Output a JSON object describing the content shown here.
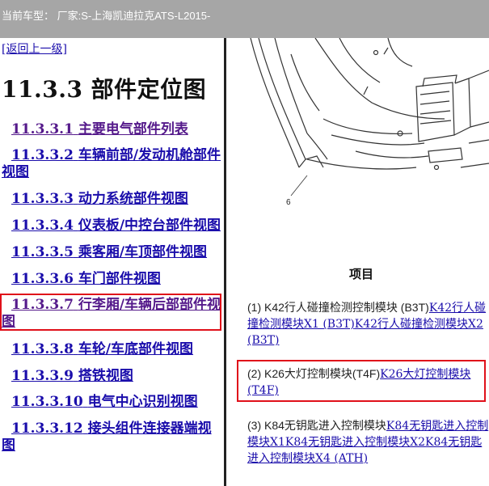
{
  "header": {
    "title": "当前车型：   厂家:S-上海凯迪拉克ATS-L2015-"
  },
  "left": {
    "back_link": "[返回上一级]",
    "heading": "11.3.3 部件定位图",
    "nav": [
      {
        "num": "11.3.3.1",
        "label": "主要电气部件列表"
      },
      {
        "num": "11.3.3.2",
        "label": "车辆前部/发动机舱部件",
        "cont": "视图"
      },
      {
        "num": "11.3.3.3",
        "label": "动力系统部件视图"
      },
      {
        "num": "11.3.3.4",
        "label": "仪表板/中控台部件视图"
      },
      {
        "num": "11.3.3.5",
        "label": "乘客厢/车顶部件视图"
      },
      {
        "num": "11.3.3.6",
        "label": "车门部件视图"
      },
      {
        "num": "11.3.3.7",
        "label": "行李厢/车辆后部部件视",
        "cont": "图"
      },
      {
        "num": "11.3.3.8",
        "label": "车轮/车底部件视图"
      },
      {
        "num": "11.3.3.9",
        "label": "搭铁视图"
      },
      {
        "num": "11.3.3.10",
        "label": "电气中心识别视图"
      },
      {
        "num": "11.3.3.12",
        "label": "接头组件连接器端视",
        "cont": "图"
      }
    ]
  },
  "right": {
    "callout_number": "6",
    "items_header": "项目",
    "items": [
      {
        "prefix": "(1) K42行人碰撞检测控制模块 (B3T)",
        "link1": "K42行人碰撞检测模块X1 (B3T)",
        "link2": "K42行人碰撞检测模块X2 (B3T)"
      },
      {
        "prefix": "(2) K26大灯控制模块(T4F)",
        "link1": "K26大灯控制模块 (T4F)"
      },
      {
        "prefix": "(3) K84无钥匙进入控制模块",
        "link1": "K84无钥匙进入控制模块X1",
        "link2": "K84无钥匙进入控制模块X2",
        "link3": "K84无钥匙进入控制模块X4 (ATH)"
      }
    ]
  },
  "colors": {
    "topbar": "#a6a6a6",
    "link": "#1a0dab",
    "visited": "#551a8b",
    "highlight": "#e0101a"
  }
}
